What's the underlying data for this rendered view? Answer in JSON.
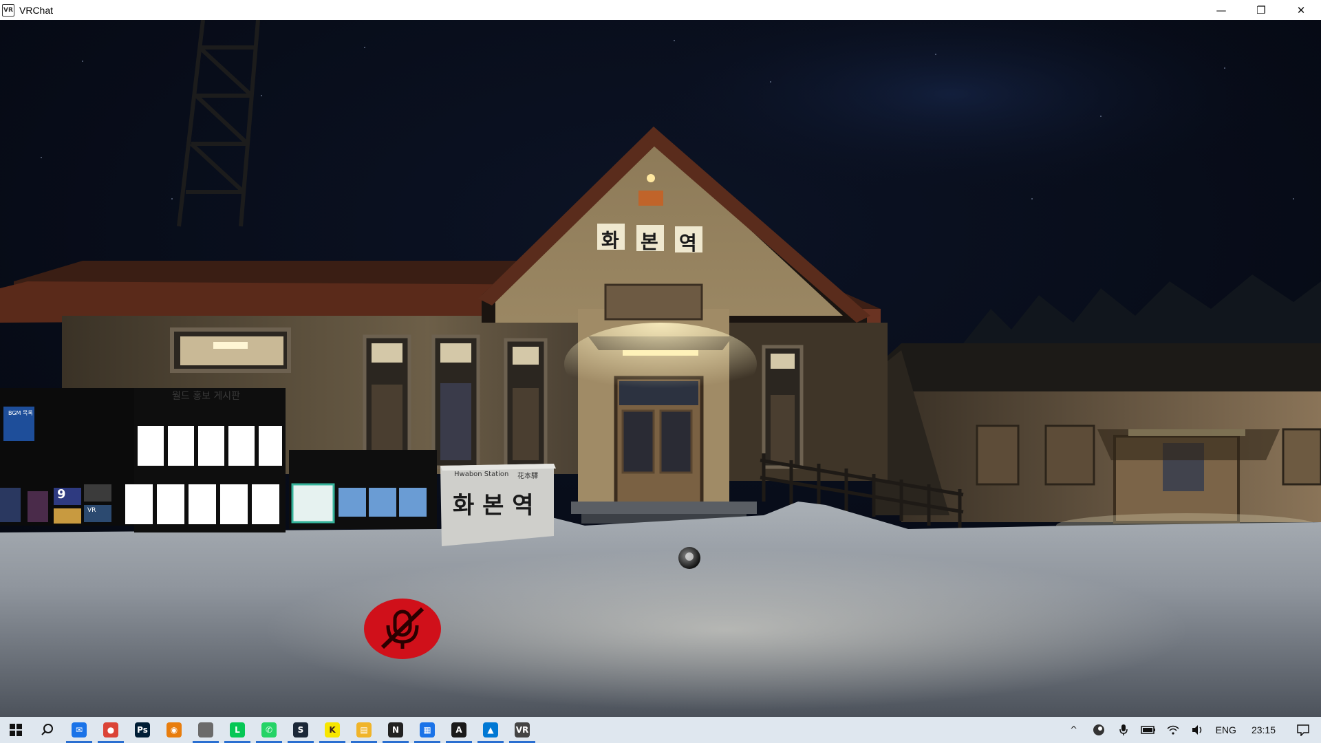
{
  "window": {
    "title": "VRChat",
    "app_icon": "VR",
    "controls": {
      "minimize": "—",
      "restore": "❐",
      "close": "✕"
    }
  },
  "scene": {
    "station_sign_roof": [
      "화",
      "본",
      "역"
    ],
    "station_stone_english": "Hwabon Station",
    "station_stone_hanja": "花本驛",
    "station_stone_korean": "화 본 역",
    "notice_board_header": "월드 홍보 게시판",
    "poster_bgm_label": "BGM 목록",
    "poster_number": "9",
    "poster_vr_label": "VR",
    "mute_indicator_icon": "microphone-muted-icon",
    "colors": {
      "sky": "#0a0f1e",
      "snow": "#c9cdd2",
      "wall_lit": "#a8946e",
      "roof": "#4a2418",
      "mute_red": "#d0101a"
    }
  },
  "taskbar": {
    "apps": [
      {
        "name": "mail",
        "glyph": "✉",
        "color": "#1a73e8",
        "active": true
      },
      {
        "name": "chrome",
        "glyph": "●",
        "color": "#db4437",
        "active": true
      },
      {
        "name": "photoshop",
        "glyph": "Ps",
        "color": "#001e36",
        "active": false
      },
      {
        "name": "blender",
        "glyph": "◉",
        "color": "#e87d0d",
        "active": false
      },
      {
        "name": "apple",
        "glyph": "",
        "color": "#6b6b6b",
        "active": true
      },
      {
        "name": "line",
        "glyph": "L",
        "color": "#06c755",
        "active": true
      },
      {
        "name": "whatsapp",
        "glyph": "✆",
        "color": "#25d366",
        "active": true
      },
      {
        "name": "steam",
        "glyph": "S",
        "color": "#1b2838",
        "active": true
      },
      {
        "name": "kakaotalk",
        "glyph": "K",
        "color": "#f7e600",
        "active": true
      },
      {
        "name": "file-explorer",
        "glyph": "▤",
        "color": "#f0b429",
        "active": true
      },
      {
        "name": "notion",
        "glyph": "N",
        "color": "#222222",
        "active": true
      },
      {
        "name": "calendar",
        "glyph": "▦",
        "color": "#1a73e8",
        "active": true
      },
      {
        "name": "acrobat",
        "glyph": "A",
        "color": "#1a1a1a",
        "active": true
      },
      {
        "name": "photos",
        "glyph": "▲",
        "color": "#0078d4",
        "active": true
      },
      {
        "name": "vrchat",
        "glyph": "VR",
        "color": "#444444",
        "active": true
      }
    ],
    "tray": {
      "chevron": "^",
      "language": "ENG",
      "time": "23:15"
    }
  }
}
